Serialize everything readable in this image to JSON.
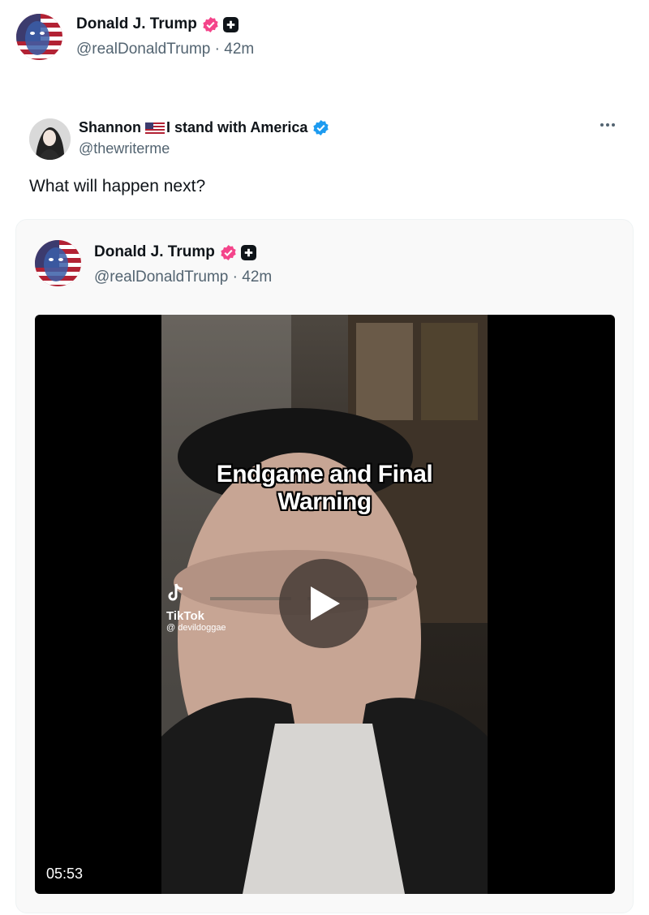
{
  "post": {
    "author_name": "Donald J. Trump",
    "author_handle": "@realDonaldTrump",
    "time": "42m",
    "separator": " · "
  },
  "reply": {
    "author_name_before": "Shannon",
    "author_name_after": "I stand with America",
    "author_handle": "@thewriterme",
    "text": "What will happen next?"
  },
  "quote": {
    "author_name": "Donald J. Trump",
    "author_handle": "@realDonaldTrump",
    "time": "42m",
    "separator": " · ",
    "video": {
      "caption_line1": "Endgame and Final",
      "caption_line2": "Warning",
      "watermark_brand": "TikTok",
      "watermark_user": "@ devildoggae",
      "duration": "05:53"
    }
  },
  "colors": {
    "text": "#0f1419",
    "secondary": "#536471",
    "verified_pink": "#f4448a",
    "verified_blue": "#1d9bf0"
  },
  "icons": {
    "gold_badge": "verified-badge-icon",
    "plus": "plus-icon",
    "flag": "us-flag-icon",
    "more": "more-icon",
    "play": "play-icon"
  }
}
